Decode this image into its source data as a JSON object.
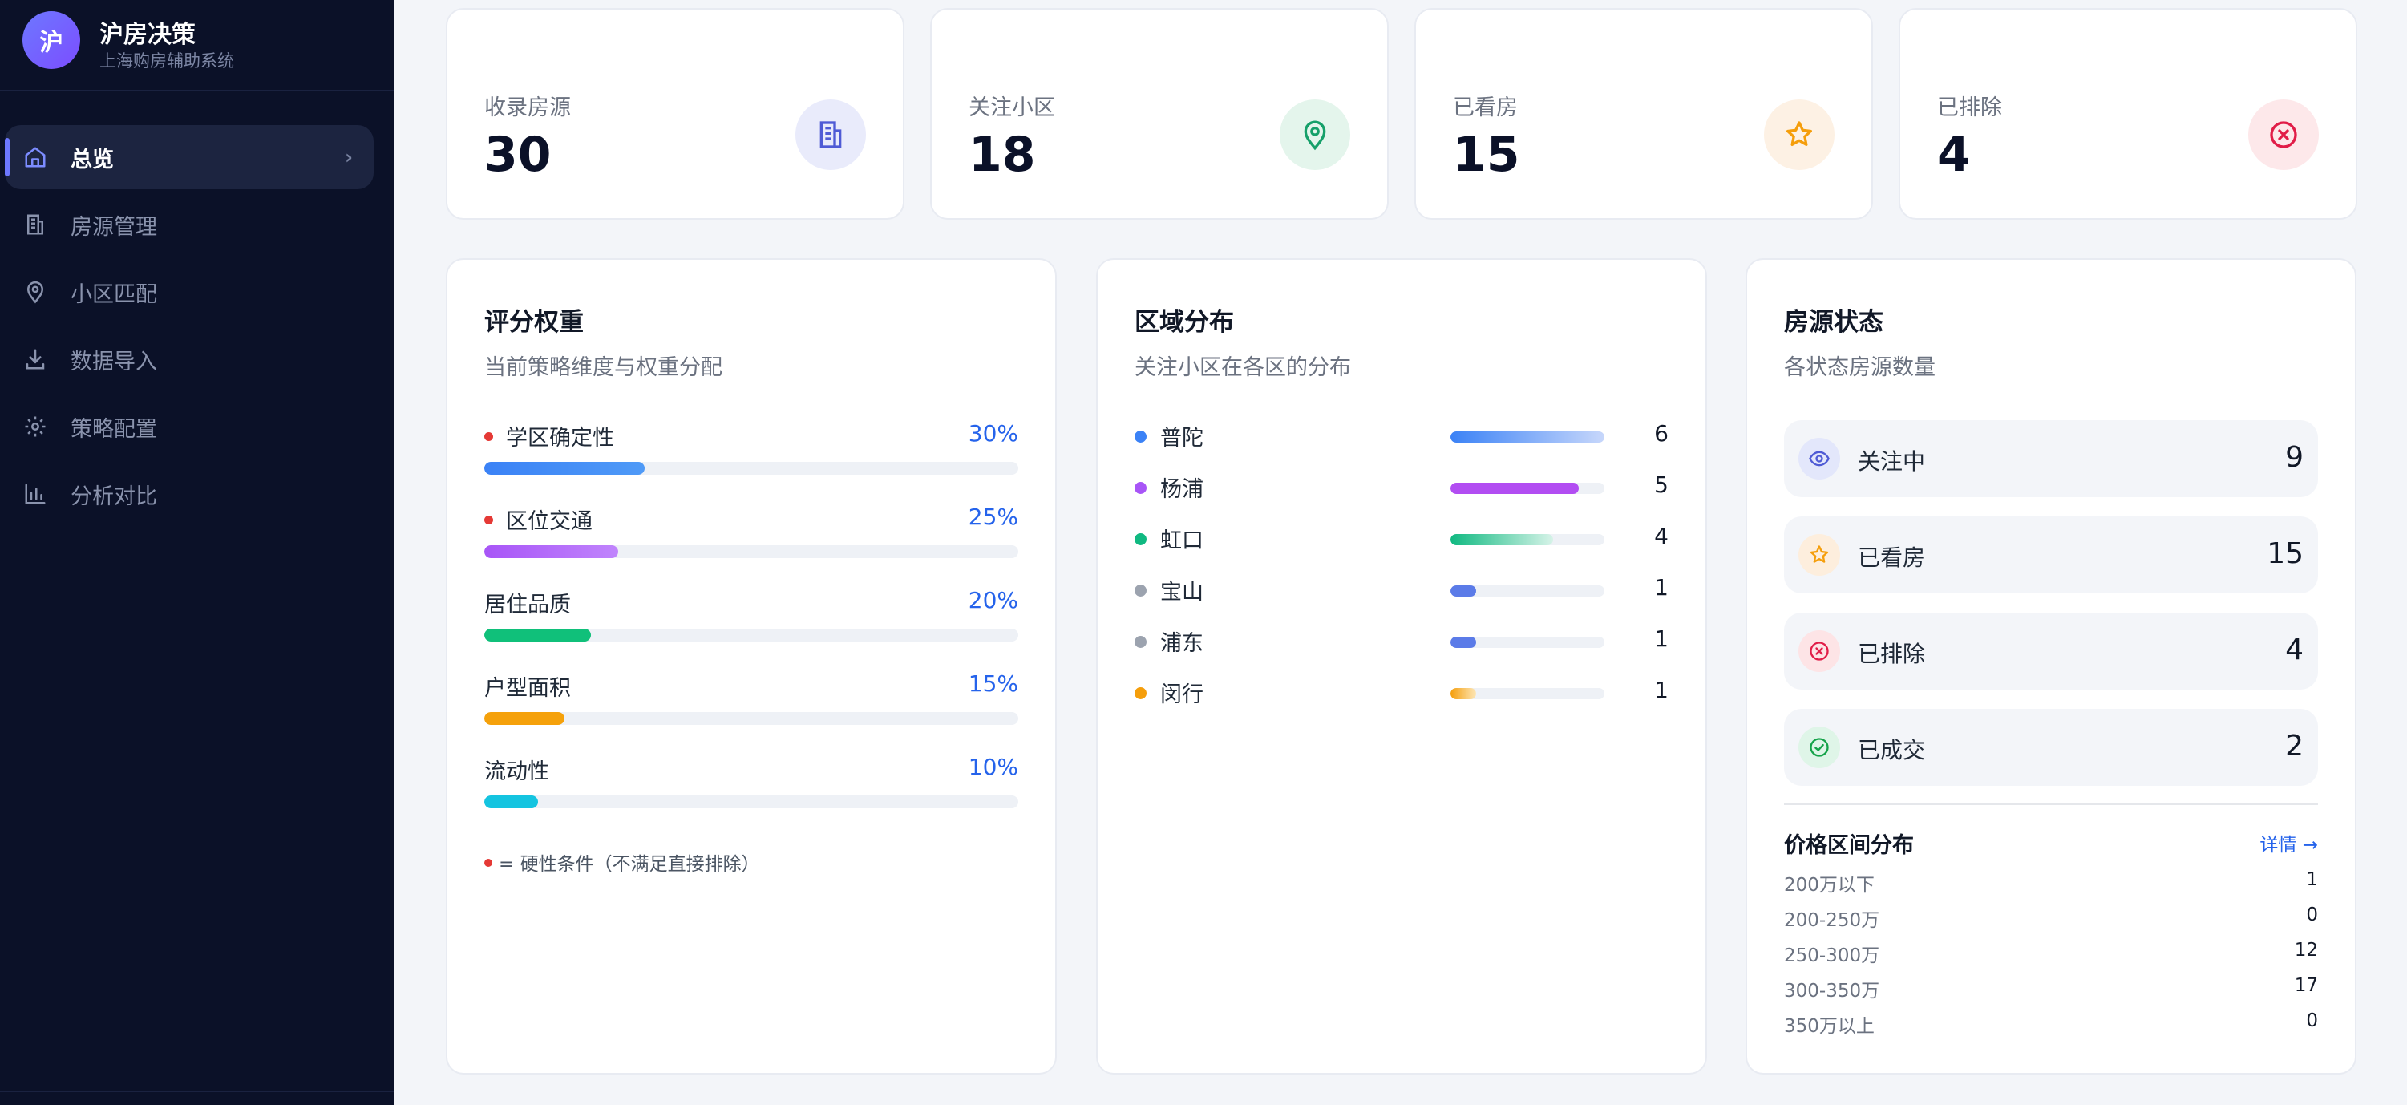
{
  "brand": {
    "logo_char": "沪",
    "name": "沪房决策",
    "subtitle": "上海购房辅助系统"
  },
  "nav": {
    "items": [
      {
        "label": "总览",
        "icon": "home-icon",
        "active": true
      },
      {
        "label": "房源管理",
        "icon": "building-icon",
        "active": false
      },
      {
        "label": "小区匹配",
        "icon": "map-pin-icon",
        "active": false
      },
      {
        "label": "数据导入",
        "icon": "download-icon",
        "active": false
      },
      {
        "label": "策略配置",
        "icon": "gear-icon",
        "active": false
      },
      {
        "label": "分析对比",
        "icon": "bar-chart-icon",
        "active": false
      }
    ],
    "arrow": "›"
  },
  "stats": [
    {
      "label": "收录房源",
      "value": "30",
      "icon": "building-icon",
      "bg": "#e9ebfb",
      "color": "#4f5bd5"
    },
    {
      "label": "关注小区",
      "value": "18",
      "icon": "map-pin-icon",
      "bg": "#e4f5ec",
      "color": "#16a06a"
    },
    {
      "label": "已看房",
      "value": "15",
      "icon": "star-icon",
      "bg": "#fdf1e4",
      "color": "#f59e0b"
    },
    {
      "label": "已排除",
      "value": "4",
      "icon": "x-circle-icon",
      "bg": "#fde8ea",
      "color": "#e11d48"
    }
  ],
  "weights": {
    "title": "评分权重",
    "subtitle": "当前策略维度与权重分配",
    "items": [
      {
        "name": "学区确定性",
        "pct_label": "30%",
        "value": 30,
        "hard": true,
        "color": "linear-gradient(90deg,#3b82f6,#4f9af7)"
      },
      {
        "name": "区位交通",
        "pct_label": "25%",
        "value": 25,
        "hard": true,
        "color": "linear-gradient(90deg,#a855f7,#c084fc)"
      },
      {
        "name": "居住品质",
        "pct_label": "20%",
        "value": 20,
        "hard": false,
        "color": "#10c07a"
      },
      {
        "name": "户型面积",
        "pct_label": "15%",
        "value": 15,
        "hard": false,
        "color": "#f5a10b"
      },
      {
        "name": "流动性",
        "pct_label": "10%",
        "value": 10,
        "hard": false,
        "color": "#14c4e0"
      }
    ],
    "note": "= 硬性条件（不满足直接排除）"
  },
  "districts": {
    "title": "区域分布",
    "subtitle": "关注小区在各区的分布",
    "max": 6,
    "items": [
      {
        "name": "普陀",
        "count": 6,
        "dot": "#3b82f6",
        "fill": "linear-gradient(90deg,#3b82f6,#c7d7fb)"
      },
      {
        "name": "杨浦",
        "count": 5,
        "dot": "#a855f7",
        "fill": "#b24df2"
      },
      {
        "name": "虹口",
        "count": 4,
        "dot": "#10b981",
        "fill": "linear-gradient(90deg,#10b981,#d6f3e8)"
      },
      {
        "name": "宝山",
        "count": 1,
        "dot": "#9ca3af",
        "fill": "#5b7be8"
      },
      {
        "name": "浦东",
        "count": 1,
        "dot": "#9ca3af",
        "fill": "#5b7be8"
      },
      {
        "name": "闵行",
        "count": 1,
        "dot": "#f59e0b",
        "fill": "linear-gradient(90deg,#f59e0b,#fde7b8)"
      }
    ]
  },
  "status": {
    "title": "房源状态",
    "subtitle": "各状态房源数量",
    "items": [
      {
        "label": "关注中",
        "count": "9",
        "icon": "eye-icon",
        "bg": "#e3e7fb",
        "color": "#4f5bd5"
      },
      {
        "label": "已看房",
        "count": "15",
        "icon": "star-icon",
        "bg": "#fdeedd",
        "color": "#f59e0b"
      },
      {
        "label": "已排除",
        "count": "4",
        "icon": "x-circle-icon",
        "bg": "#fde4e6",
        "color": "#e11d48"
      },
      {
        "label": "已成交",
        "count": "2",
        "icon": "check-circle-icon",
        "bg": "#dff5e8",
        "color": "#16a34a"
      }
    ],
    "price": {
      "title": "价格区间分布",
      "link": "详情 →",
      "rows": [
        {
          "range": "200万以下",
          "count": "1"
        },
        {
          "range": "200-250万",
          "count": "0"
        },
        {
          "range": "250-300万",
          "count": "12"
        },
        {
          "range": "300-350万",
          "count": "17"
        },
        {
          "range": "350万以上",
          "count": "0"
        }
      ]
    }
  }
}
